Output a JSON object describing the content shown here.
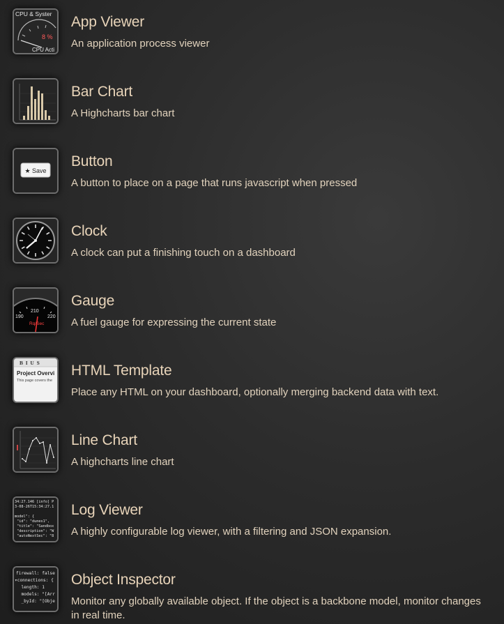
{
  "widgets": [
    {
      "title": "App Viewer",
      "description": "An application process viewer",
      "icon": "app-viewer-gauge-icon",
      "thumb": {
        "top_label": "CPU & Syster",
        "value_label": "8 %",
        "bottom_label": "CPU Acti"
      }
    },
    {
      "title": "Bar Chart",
      "description": "A Highcharts bar chart",
      "icon": "bar-chart-icon"
    },
    {
      "title": "Button",
      "description": "A button to place on a page that runs javascript when pressed",
      "icon": "button-icon",
      "thumb": {
        "button_label": "★ Save"
      }
    },
    {
      "title": "Clock",
      "description": "A clock can put a finishing touch on a dashboard",
      "icon": "clock-icon"
    },
    {
      "title": "Gauge",
      "description": "A fuel gauge for expressing the current state",
      "icon": "gauge-icon",
      "thumb": {
        "tick_left": "190",
        "tick_mid": "210",
        "tick_right": "220",
        "unit": "Rq/Sec"
      }
    },
    {
      "title": "HTML Template",
      "description": "Place any HTML on your dashboard, optionally merging backend data with text.",
      "icon": "html-template-icon",
      "thumb": {
        "toolbar": "B  I  U  S",
        "heading": "Project Overvi",
        "body": "This page covers the"
      }
    },
    {
      "title": "Line Chart",
      "description": "A highcharts line chart",
      "icon": "line-chart-icon"
    },
    {
      "title": "Log Viewer",
      "description": "A highly configurable log viewer, with a filtering and JSON expansion.",
      "icon": "log-viewer-icon",
      "thumb": {
        "lines": [
          "34:27.146 [info] P",
          "3-08-26T15:34:27.1",
          "",
          "model\": {",
          " \"id\": \"dunes1\",",
          " \"title\": \"Sandbox",
          " \"description\": \"W",
          " \"autoNextSec\": \"8"
        ]
      }
    },
    {
      "title": "Object Inspector",
      "description": "Monitor any globally available object. If the object is a backbone model, monitor changes in real time.",
      "icon": "object-inspector-icon",
      "thumb": {
        "lines": [
          "firewall: false",
          "▾connections: {",
          "  length: 1",
          "  models: \"[Arr",
          "  _byId: \"[Obje"
        ]
      }
    }
  ]
}
